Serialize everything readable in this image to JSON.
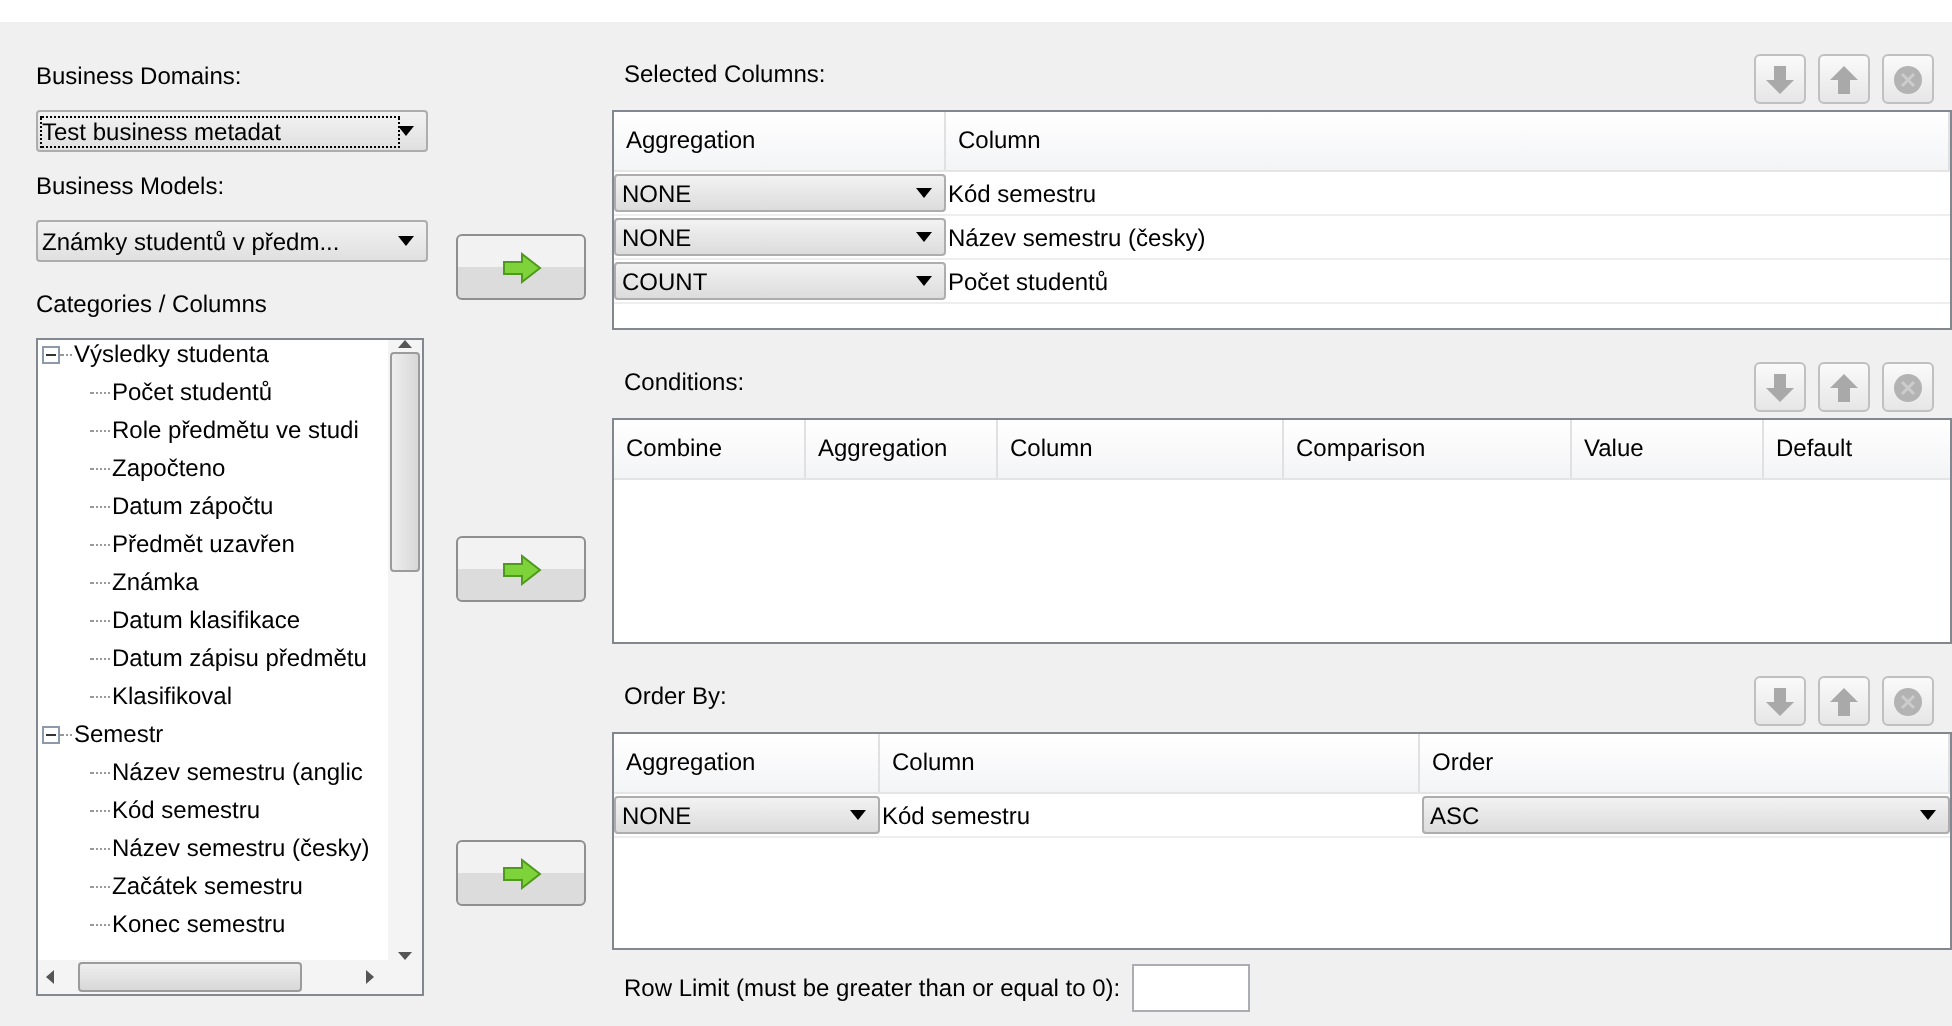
{
  "business_domains": {
    "label": "Business Domains:",
    "value": "Test business metadat"
  },
  "business_models": {
    "label": "Business Models:",
    "value": "Známky studentů v předm..."
  },
  "categories": {
    "label": "Categories / Columns",
    "tree": [
      {
        "label": "Výsledky studenta",
        "expanded": true,
        "children": [
          {
            "label": "Počet studentů"
          },
          {
            "label": "Role předmětu ve studi"
          },
          {
            "label": "Započteno"
          },
          {
            "label": "Datum zápočtu"
          },
          {
            "label": "Předmět uzavřen"
          },
          {
            "label": "Známka"
          },
          {
            "label": "Datum klasifikace"
          },
          {
            "label": "Datum zápisu předmětu"
          },
          {
            "label": "Klasifikoval"
          }
        ]
      },
      {
        "label": "Semestr",
        "expanded": true,
        "children": [
          {
            "label": "Název semestru (anglic"
          },
          {
            "label": "Kód semestru"
          },
          {
            "label": "Název semestru (česky)"
          },
          {
            "label": "Začátek semestru"
          },
          {
            "label": "Konec semestru"
          }
        ]
      }
    ]
  },
  "selected_columns": {
    "label": "Selected Columns:",
    "columns": [
      "Aggregation",
      "Column"
    ],
    "rows": [
      {
        "aggregation": "NONE",
        "column": "Kód semestru"
      },
      {
        "aggregation": "NONE",
        "column": "Název semestru (česky)"
      },
      {
        "aggregation": "COUNT",
        "column": "Počet studentů"
      }
    ]
  },
  "conditions": {
    "label": "Conditions:",
    "columns": [
      "Combine",
      "Aggregation",
      "Column",
      "Comparison",
      "Value",
      "Default"
    ]
  },
  "order_by": {
    "label": "Order By:",
    "columns": [
      "Aggregation",
      "Column",
      "Order"
    ],
    "rows": [
      {
        "aggregation": "NONE",
        "column": "Kód semestru",
        "order": "ASC"
      }
    ]
  },
  "row_limit": {
    "label": "Row Limit (must be greater than or equal to 0):"
  }
}
